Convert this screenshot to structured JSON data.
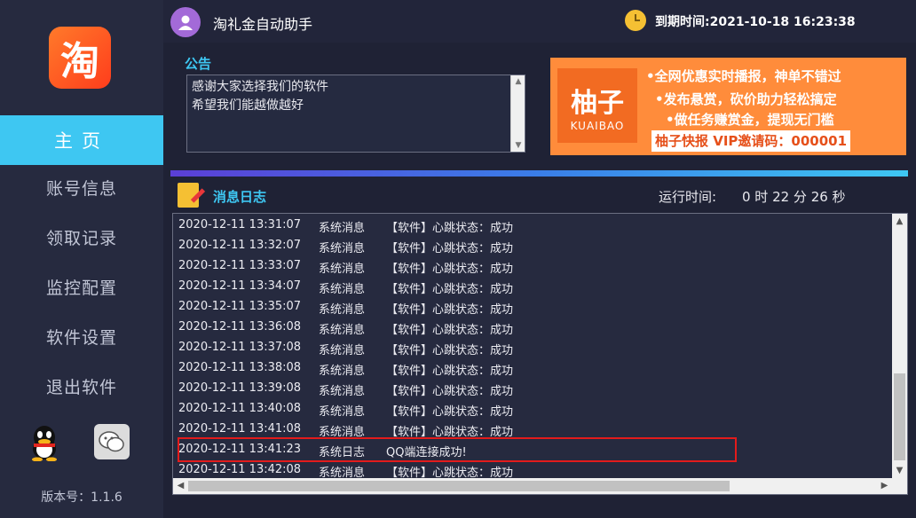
{
  "sidebar": {
    "logo_char": "淘",
    "items": [
      {
        "label": "主页",
        "active": true
      },
      {
        "label": "账号信息",
        "active": false
      },
      {
        "label": "领取记录",
        "active": false
      },
      {
        "label": "监控配置",
        "active": false
      },
      {
        "label": "软件设置",
        "active": false
      },
      {
        "label": "退出软件",
        "active": false
      }
    ],
    "version": "版本号：1.1.6"
  },
  "header": {
    "title": "淘礼金自动助手",
    "expire": "到期时间:2021-10-18 16:23:38"
  },
  "notice": {
    "title": "公告",
    "lines": [
      "感谢大家选择我们的软件",
      "希望我们能越做越好"
    ]
  },
  "ad": {
    "logo_text": "柚子",
    "logo_sub": "KUAIBAO",
    "line1": "•全网优惠实时播报，神单不错过",
    "line2": "•发布悬赏，砍价助力轻松搞定",
    "line3": "•做任务赚赏金，提现无门槛",
    "vip": "柚子快报  VIP邀请码：000001"
  },
  "log": {
    "title": "消息日志",
    "runtime_label": "运行时间:",
    "runtime_value": "0 时 22 分 26 秒",
    "rows": [
      {
        "time": "2020-12-11 13:31:07",
        "type": "系统消息",
        "msg": "【软件】心跳状态：成功"
      },
      {
        "time": "2020-12-11 13:32:07",
        "type": "系统消息",
        "msg": "【软件】心跳状态：成功"
      },
      {
        "time": "2020-12-11 13:33:07",
        "type": "系统消息",
        "msg": "【软件】心跳状态：成功"
      },
      {
        "time": "2020-12-11 13:34:07",
        "type": "系统消息",
        "msg": "【软件】心跳状态：成功"
      },
      {
        "time": "2020-12-11 13:35:07",
        "type": "系统消息",
        "msg": "【软件】心跳状态：成功"
      },
      {
        "time": "2020-12-11 13:36:08",
        "type": "系统消息",
        "msg": "【软件】心跳状态：成功"
      },
      {
        "time": "2020-12-11 13:37:08",
        "type": "系统消息",
        "msg": "【软件】心跳状态：成功"
      },
      {
        "time": "2020-12-11 13:38:08",
        "type": "系统消息",
        "msg": "【软件】心跳状态：成功"
      },
      {
        "time": "2020-12-11 13:39:08",
        "type": "系统消息",
        "msg": "【软件】心跳状态：成功"
      },
      {
        "time": "2020-12-11 13:40:08",
        "type": "系统消息",
        "msg": "【软件】心跳状态：成功"
      },
      {
        "time": "2020-12-11 13:41:08",
        "type": "系统消息",
        "msg": "【软件】心跳状态：成功"
      },
      {
        "time": "2020-12-11 13:41:23",
        "type": "系统日志",
        "msg": "QQ端连接成功!"
      },
      {
        "time": "2020-12-11 13:42:08",
        "type": "系统消息",
        "msg": "【软件】心跳状态：成功"
      }
    ]
  }
}
